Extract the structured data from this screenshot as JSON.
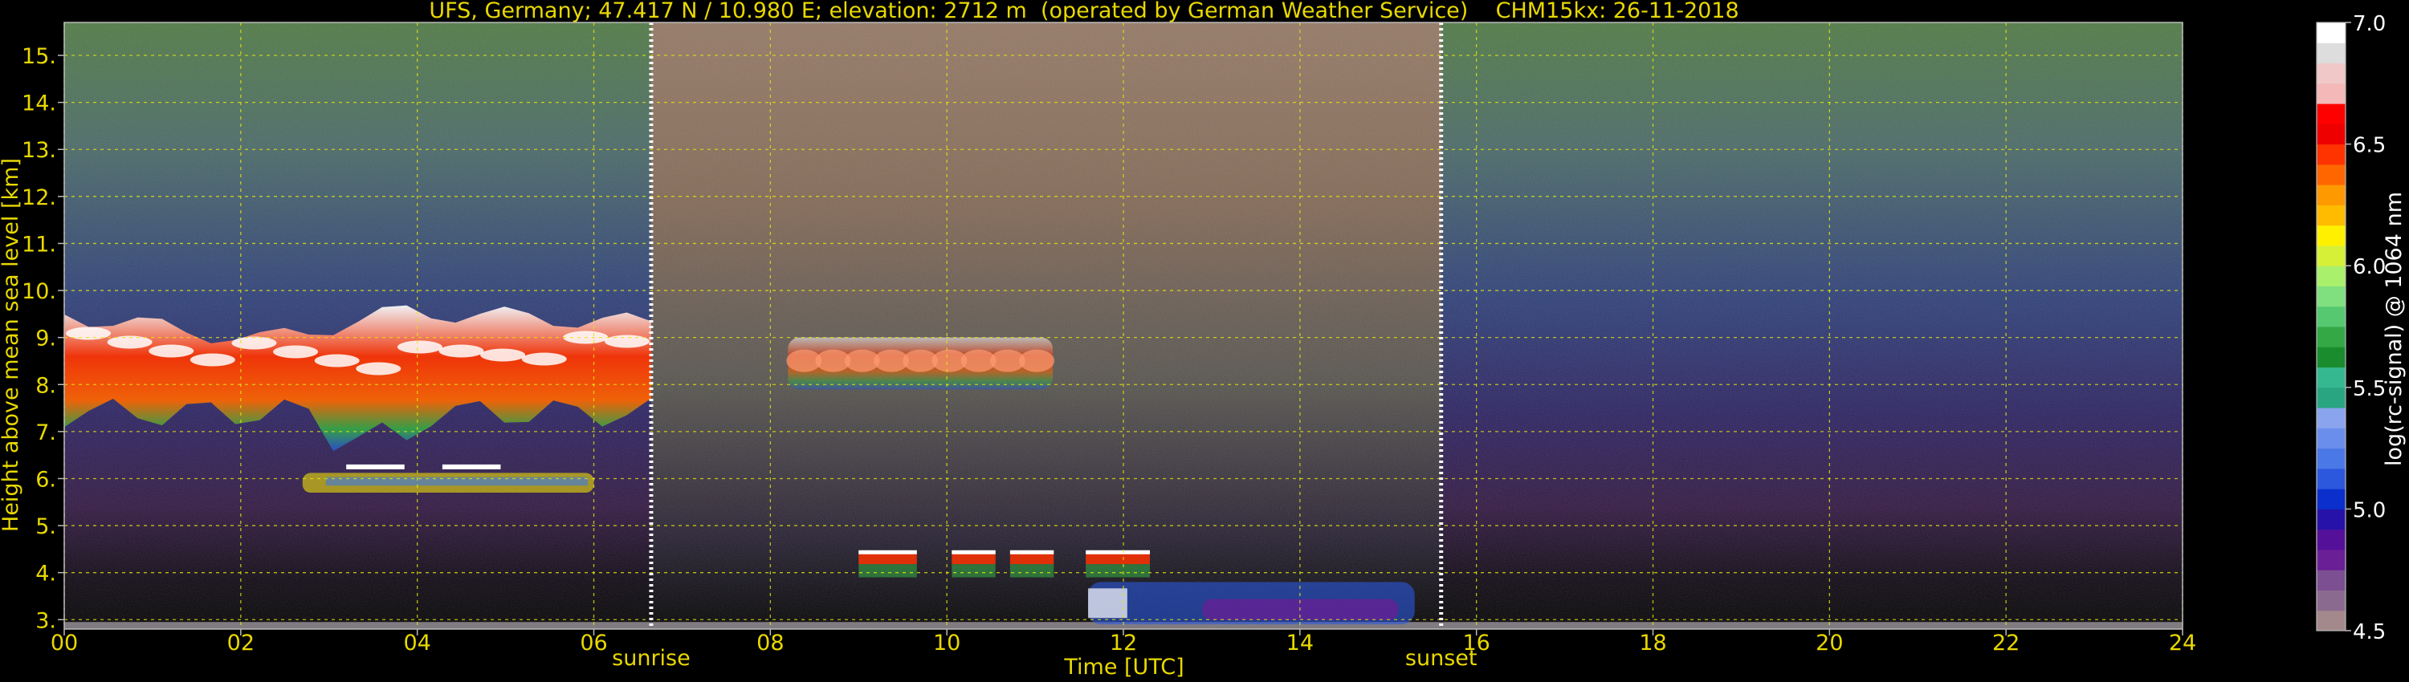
{
  "chart_data": {
    "type": "heatmap",
    "title": "UFS, Germany; 47.417 N / 10.980 E; elevation: 2712 m  (operated by German Weather Service)    CHM15kx: 26-11-2018",
    "xlabel": "Time [UTC]",
    "ylabel": "Height above mean sea level [km]",
    "xlim": [
      0,
      24
    ],
    "ylim": [
      2.8,
      15.7
    ],
    "x_ticks": [
      "00",
      "02",
      "04",
      "06",
      "08",
      "10",
      "12",
      "14",
      "16",
      "18",
      "20",
      "22",
      "24"
    ],
    "y_ticks": [
      "3.",
      "4.",
      "5.",
      "6.",
      "7.",
      "8.",
      "9.",
      "10.",
      "11.",
      "12.",
      "13.",
      "14.",
      "15."
    ],
    "grid": true,
    "grid_color": "#e5e510",
    "text_color": "#e8d800",
    "markers": [
      {
        "label": "sunrise",
        "time": 6.65
      },
      {
        "label": "sunset",
        "time": 15.6
      }
    ],
    "colorbar": {
      "label": "log(rc-signal) @ 1064 nm",
      "min": 4.5,
      "max": 7.0,
      "ticks": [
        "4.5",
        "5.0",
        "5.5",
        "6.0",
        "6.5",
        "7.0"
      ],
      "colors": [
        "#a3888c",
        "#8b6a90",
        "#7b4f91",
        "#6a1f96",
        "#55109a",
        "#2612a8",
        "#0a2fcc",
        "#2c58de",
        "#4a78e6",
        "#6a8eec",
        "#8aa4ee",
        "#2aa582",
        "#35b890",
        "#1a8c2e",
        "#33a845",
        "#55c870",
        "#80e080",
        "#a9f06c",
        "#d6f038",
        "#fff000",
        "#ffbb00",
        "#ff9900",
        "#ff6600",
        "#ff3300",
        "#ee0000",
        "#ff0000",
        "#f4b8b8",
        "#f0c8c8",
        "#dddddd",
        "#ffffff"
      ]
    },
    "features": [
      {
        "name": "cirrus-main",
        "t0": 0.0,
        "t1": 6.65,
        "zbot": 7.4,
        "ztop": 9.6,
        "level": 6.5
      },
      {
        "name": "cirrus-mid",
        "t0": 8.2,
        "t1": 11.2,
        "zbot": 7.9,
        "ztop": 9.0,
        "level": 6.5
      },
      {
        "name": "layer-6km",
        "t0": 2.7,
        "t1": 6.0,
        "zbot": 5.7,
        "ztop": 6.3,
        "level": 6.1
      },
      {
        "name": "low-cloud",
        "t0": 9.0,
        "t1": 12.3,
        "zbot": 3.9,
        "ztop": 4.7,
        "level": 6.6
      },
      {
        "name": "boundary-layer",
        "t0": 11.6,
        "t1": 15.3,
        "zbot": 2.9,
        "ztop": 3.8,
        "level": 5.4
      }
    ]
  }
}
